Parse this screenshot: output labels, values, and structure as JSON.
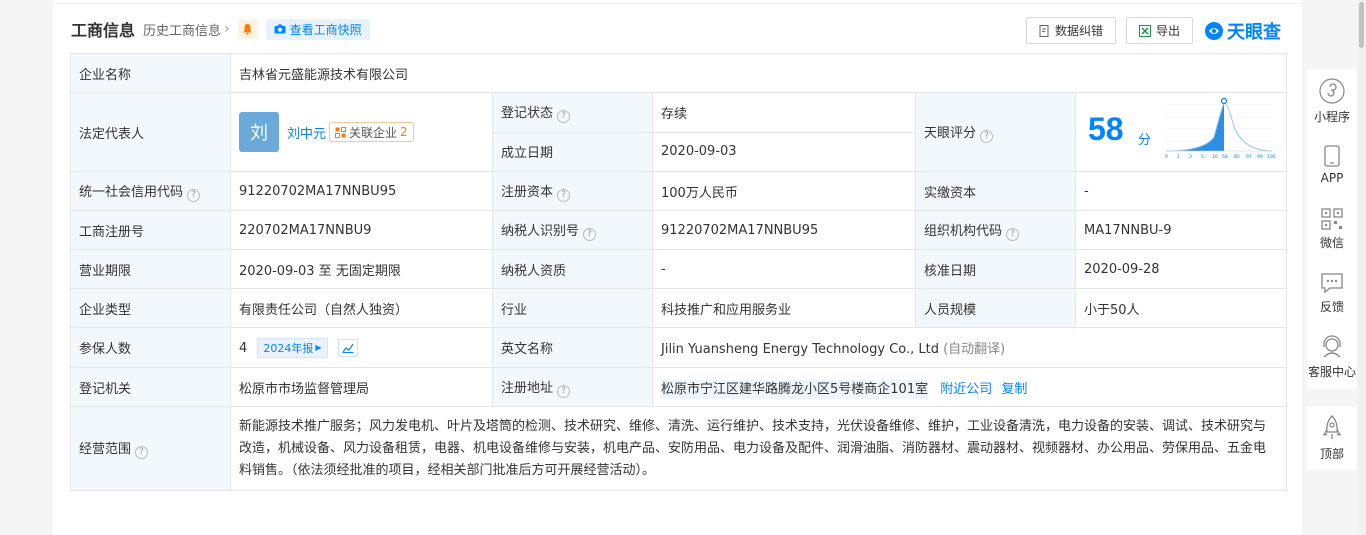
{
  "header": {
    "title": "工商信息",
    "history_label": "历史工商信息",
    "snapshot_label": "查看工商快照",
    "data_correction_label": "数据纠错",
    "export_label": "导出",
    "brand": "天眼查"
  },
  "rows": {
    "company_name_label": "企业名称",
    "company_name": "吉林省元盛能源技术有限公司",
    "legal_rep_label": "法定代表人",
    "legal_avatar_char": "刘",
    "legal_rep_name": "刘中元",
    "related_label": "关联企业",
    "related_count": "2",
    "reg_status_label": "登记状态",
    "reg_status": "存续",
    "established_label": "成立日期",
    "established": "2020-09-03",
    "score_label": "天眼评分",
    "score": "58",
    "score_unit": "分",
    "credit_code_label": "统一社会信用代码",
    "credit_code": "91220702MA17NNBU95",
    "reg_capital_label": "注册资本",
    "reg_capital": "100万人民币",
    "paid_capital_label": "实缴资本",
    "paid_capital": "-",
    "reg_no_label": "工商注册号",
    "reg_no": "220702MA17NNBU9",
    "taxpayer_id_label": "纳税人识别号",
    "taxpayer_id": "91220702MA17NNBU95",
    "org_code_label": "组织机构代码",
    "org_code": "MA17NNBU-9",
    "term_label": "营业期限",
    "term": "2020-09-03 至 无固定期限",
    "taxpayer_qual_label": "纳税人资质",
    "taxpayer_qual": "-",
    "approval_date_label": "核准日期",
    "approval_date": "2020-09-28",
    "company_type_label": "企业类型",
    "company_type": "有限责任公司（自然人独资）",
    "industry_label": "行业",
    "industry": "科技推广和应用服务业",
    "staff_size_label": "人员规模",
    "staff_size": "小于50人",
    "insured_label": "参保人数",
    "insured": "4",
    "report_label": "2024年报",
    "english_name_label": "英文名称",
    "english_name": "Jilin Yuansheng Energy Technology Co., Ltd",
    "auto_translate": "(自动翻译)",
    "authority_label": "登记机关",
    "authority": "松原市市场监督管理局",
    "address_label": "注册地址",
    "address": "松原市宁江区建华路腾龙小区5号楼商企101室",
    "nearby_label": "附近公司",
    "copy_label": "复制",
    "scope_label": "经营范围",
    "scope": "新能源技术推广服务；风力发电机、叶片及塔筒的检测、技术研究、维修、清洗、运行维护、技术支持，光伏设备维修、维护，工业设备清洗，电力设备的安装、调试、技术研究与改造，机械设备、风力设备租赁，电器、机电设备维修与安装，机电产品、安防用品、电力设备及配件、润滑油脂、消防器材、震动器材、视频器材、办公用品、劳保用品、五金电料销售。（依法须经批准的项目，经相关部门批准后方可开展经营活动）。"
  },
  "score_chart": {
    "ticks": [
      "0",
      "1",
      "3",
      "5",
      "10",
      "58",
      "85",
      "97",
      "99",
      "100"
    ]
  },
  "sidebar": {
    "mini_program": "小程序",
    "app": "APP",
    "wechat": "微信",
    "feedback": "反馈",
    "service": "客服中心",
    "top": "顶部"
  },
  "colors": {
    "accent": "#0084ff",
    "label_bg": "#f3f8fd",
    "status_green": "#1aa261"
  }
}
